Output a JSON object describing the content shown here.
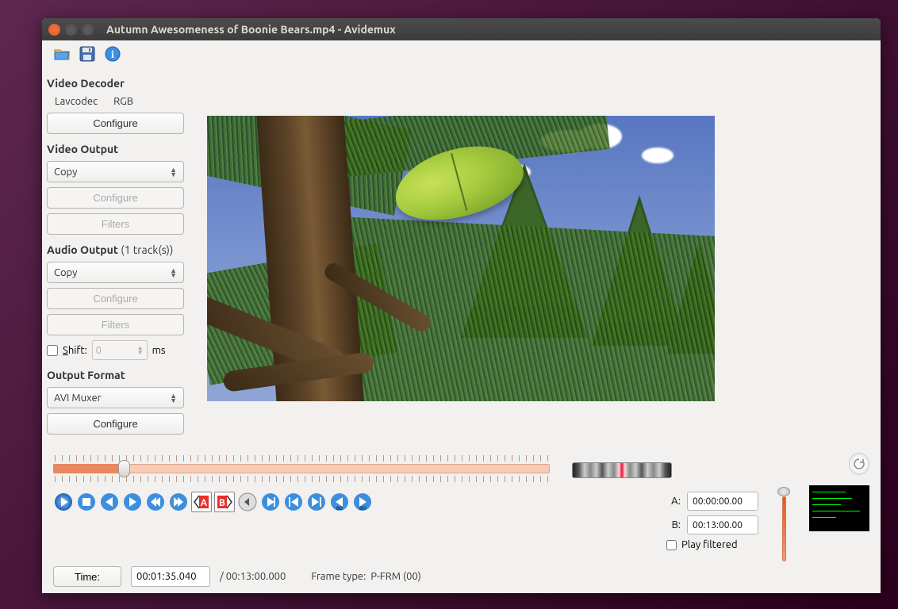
{
  "window": {
    "title": "Autumn Awesomeness of Boonie Bears.mp4 - Avidemux"
  },
  "toolbar": {
    "open": "open-icon",
    "save": "save-icon",
    "info": "info-icon"
  },
  "sidebar": {
    "decoder": {
      "title": "Video Decoder",
      "codec": "Lavcodec",
      "colorspace": "RGB",
      "configure": "Configure"
    },
    "video_output": {
      "title": "Video Output",
      "value": "Copy",
      "configure": "Configure",
      "filters": "Filters"
    },
    "audio_output": {
      "title": "Audio Output",
      "suffix": "(1 track(s))",
      "value": "Copy",
      "configure": "Configure",
      "filters": "Filters",
      "shift_label": "Shift:",
      "shift_value": "0",
      "shift_unit": "ms"
    },
    "output_format": {
      "title": "Output Format",
      "value": "AVI Muxer",
      "configure": "Configure"
    }
  },
  "timeline": {
    "position_pct": 12,
    "a": {
      "label": "A:",
      "value": "00:00:00.00"
    },
    "b": {
      "label": "B:",
      "value": "00:13:00.00"
    },
    "play_filtered": "Play filtered"
  },
  "info": {
    "time_label": "Time:",
    "time_value": "00:01:35.040",
    "duration": "/ 00:13:00.000",
    "frame_label": "Frame type:",
    "frame_value": "P-FRM (00)"
  },
  "buttons": {
    "play": "play",
    "stop": "stop",
    "prev": "prev-frame",
    "next": "next-frame",
    "prev_key": "prev-keyframe",
    "next_key": "next-keyframe",
    "mark_a": "set-marker-a",
    "mark_b": "set-marker-b",
    "prev_cut": "prev-cut",
    "next_cut": "next-cut",
    "prev_black": "prev-black",
    "next_black": "next-black",
    "goto_a": "goto-marker-a",
    "goto_b": "goto-marker-b"
  }
}
